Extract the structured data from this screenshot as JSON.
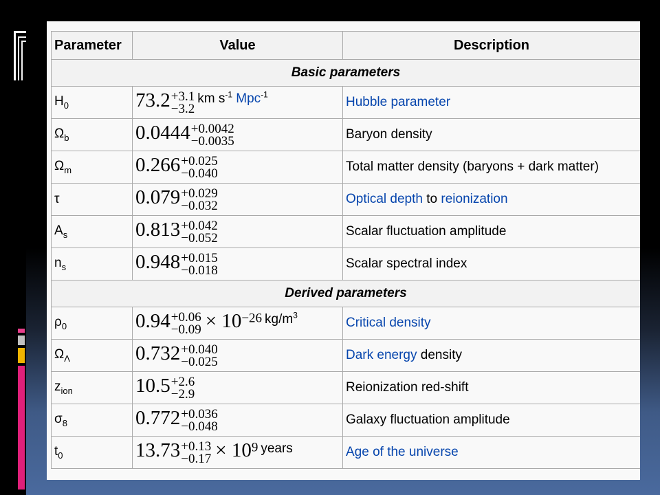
{
  "colors": {
    "link": "#0645ad",
    "header_bg": "#f2f2f2",
    "border": "#aaaaaa"
  },
  "table": {
    "headers": [
      "Parameter",
      "Value",
      "Description"
    ],
    "sections": {
      "basic": "Basic parameters",
      "derived": "Derived parameters"
    },
    "rows": [
      {
        "sym": "H",
        "sub": "0",
        "num": "73.2",
        "sup": "+3.1",
        "sub_err": "−3.2",
        "unit": "km s",
        "unit_sup": "-1",
        "unit_link": "Mpc",
        "unit_link_sup": "-1",
        "desc_link": "Hubble parameter"
      },
      {
        "sym": "Ω",
        "sub": "b",
        "num": "0.0444",
        "sup": "+0.0042",
        "sub_err": "−0.0035",
        "desc": "Baryon density"
      },
      {
        "sym": "Ω",
        "sub": "m",
        "num": "0.266",
        "sup": "+0.025",
        "sub_err": "−0.040",
        "desc": "Total matter density (baryons + dark matter)"
      },
      {
        "sym": "τ",
        "num": "0.079",
        "sup": "+0.029",
        "sub_err": "−0.032",
        "desc_link": "Optical depth",
        "desc_mid": "to",
        "desc_link2": "reionization"
      },
      {
        "sym": "A",
        "sub": "s",
        "num": "0.813",
        "sup": "+0.042",
        "sub_err": "−0.052",
        "desc": "Scalar fluctuation amplitude"
      },
      {
        "sym": "n",
        "sub": "s",
        "num": "0.948",
        "sup": "+0.015",
        "sub_err": "−0.018",
        "desc": "Scalar spectral index"
      },
      {
        "sym": "ρ",
        "sub": "0",
        "num": "0.94",
        "sup": "+0.06",
        "sub_err": "−0.09",
        "times": "× 10",
        "exp": "−26",
        "unit": "kg/m",
        "unit_sup": "3",
        "desc_link": "Critical density"
      },
      {
        "sym": "Ω",
        "sub": "Λ",
        "num": "0.732",
        "sup": "+0.040",
        "sub_err": "−0.025",
        "desc_link": "Dark energy",
        "desc": "density"
      },
      {
        "sym": "z",
        "sub": "ion",
        "num": "10.5",
        "sup": "+2.6",
        "sub_err": "−2.9",
        "desc": "Reionization red-shift"
      },
      {
        "sym": "σ",
        "sub": "8",
        "num": "0.772",
        "sup": "+0.036",
        "sub_err": "−0.048",
        "desc": "Galaxy fluctuation amplitude"
      },
      {
        "sym": "t",
        "sub": "0",
        "num": "13.73",
        "sup": "+0.13",
        "sub_err": "−0.17",
        "times": "× 10",
        "exp": "9",
        "unit": "years",
        "desc_link": "Age of the universe"
      }
    ]
  }
}
